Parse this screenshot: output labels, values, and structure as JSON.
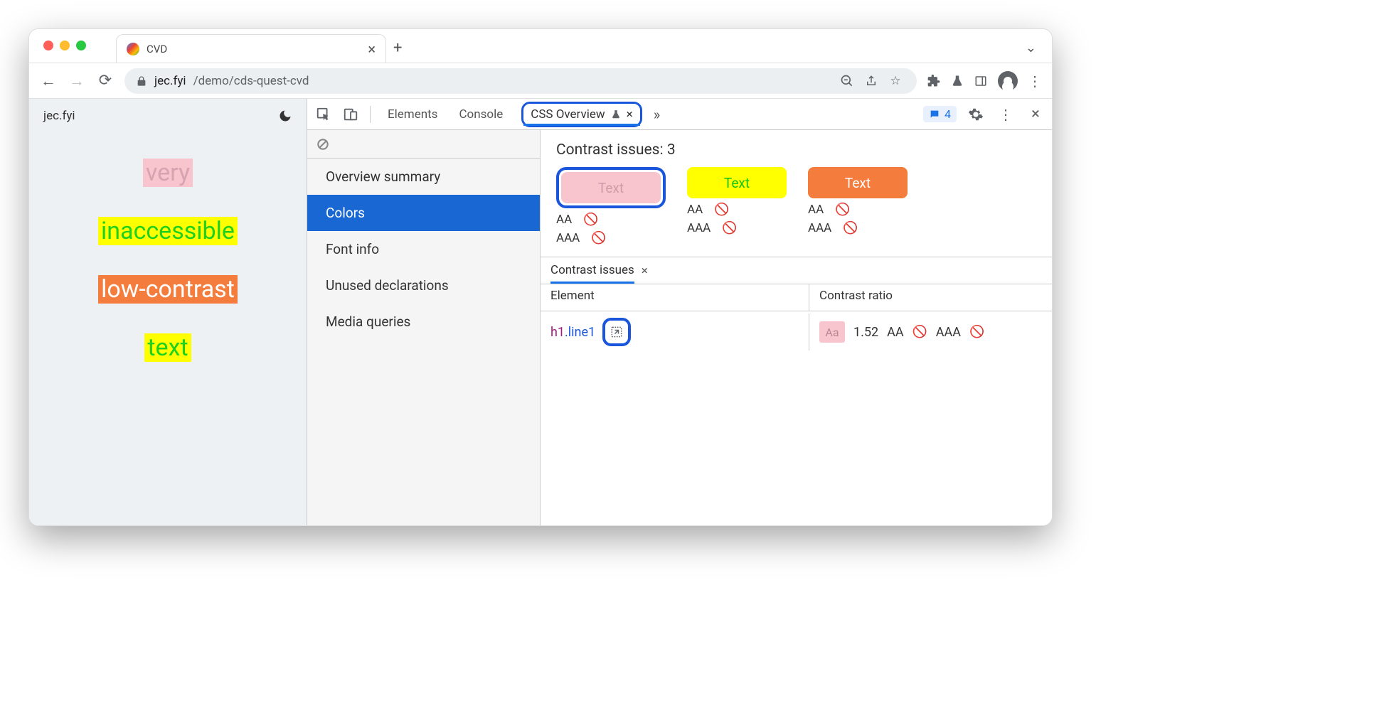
{
  "browser": {
    "tab_title": "CVD",
    "url_host": "jec.fyi",
    "url_path": "/demo/cds-quest-cvd"
  },
  "page": {
    "site_name": "jec.fyi",
    "words": [
      "very",
      "inaccessible",
      "low-contrast",
      "text"
    ]
  },
  "devtools": {
    "tabs": [
      "Elements",
      "Console",
      "CSS Overview"
    ],
    "active_tab": "CSS Overview",
    "issues_badge": "4",
    "overview_nav": [
      "Overview summary",
      "Colors",
      "Font info",
      "Unused declarations",
      "Media queries"
    ],
    "overview_active": "Colors",
    "contrast": {
      "title_prefix": "Contrast issues:",
      "count": "3",
      "cards": [
        {
          "label": "Text",
          "bg": "#f8c5cf",
          "fg": "#cc9ba7"
        },
        {
          "label": "Text",
          "bg": "#ffff00",
          "fg": "#13c313"
        },
        {
          "label": "Text",
          "bg": "#f47c3c",
          "fg": "#ffffff"
        }
      ],
      "aa_label": "AA",
      "aaa_label": "AAA",
      "issues_tab_label": "Contrast issues",
      "table": {
        "headers": {
          "element": "Element",
          "contrast_ratio": "Contrast ratio"
        },
        "row": {
          "selector_tag": "h1",
          "selector_class": ".line1",
          "ratio": "1.52",
          "aa_box": "Aa",
          "aa_label": "AA",
          "aaa_label": "AAA"
        }
      }
    }
  }
}
